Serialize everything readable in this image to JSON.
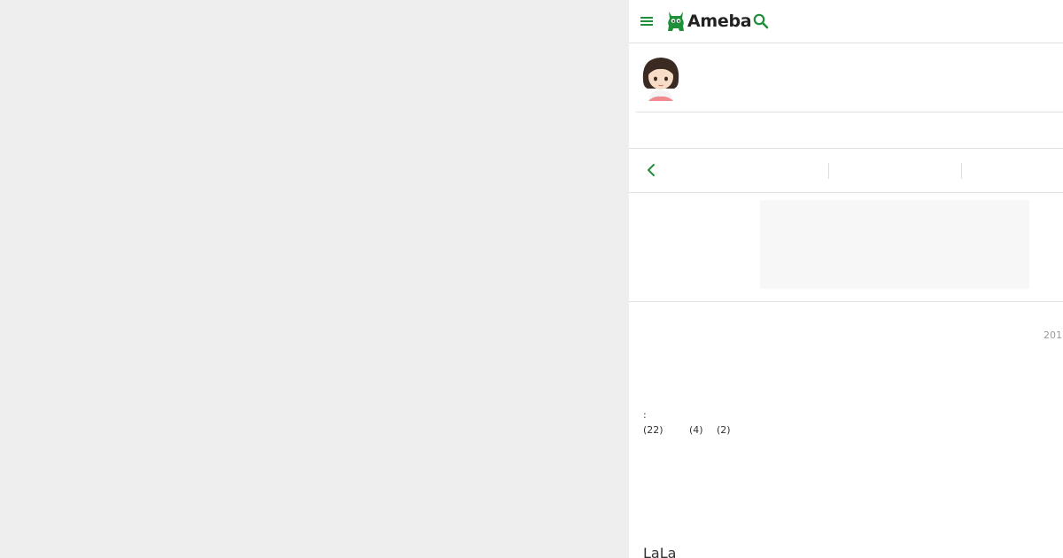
{
  "header": {
    "logo_text": "Ameba",
    "brand_color": "#1f8f3a",
    "icons": [
      "hamburger-menu-icon",
      "ameba-logo-icon",
      "search-icon"
    ]
  },
  "nav": {
    "icons": [
      "chevron-left-icon"
    ]
  },
  "entry": {
    "date": "201",
    "colon": ":",
    "counts": [
      "(22)",
      "(4)",
      "(2)"
    ],
    "title": "LaLa"
  }
}
